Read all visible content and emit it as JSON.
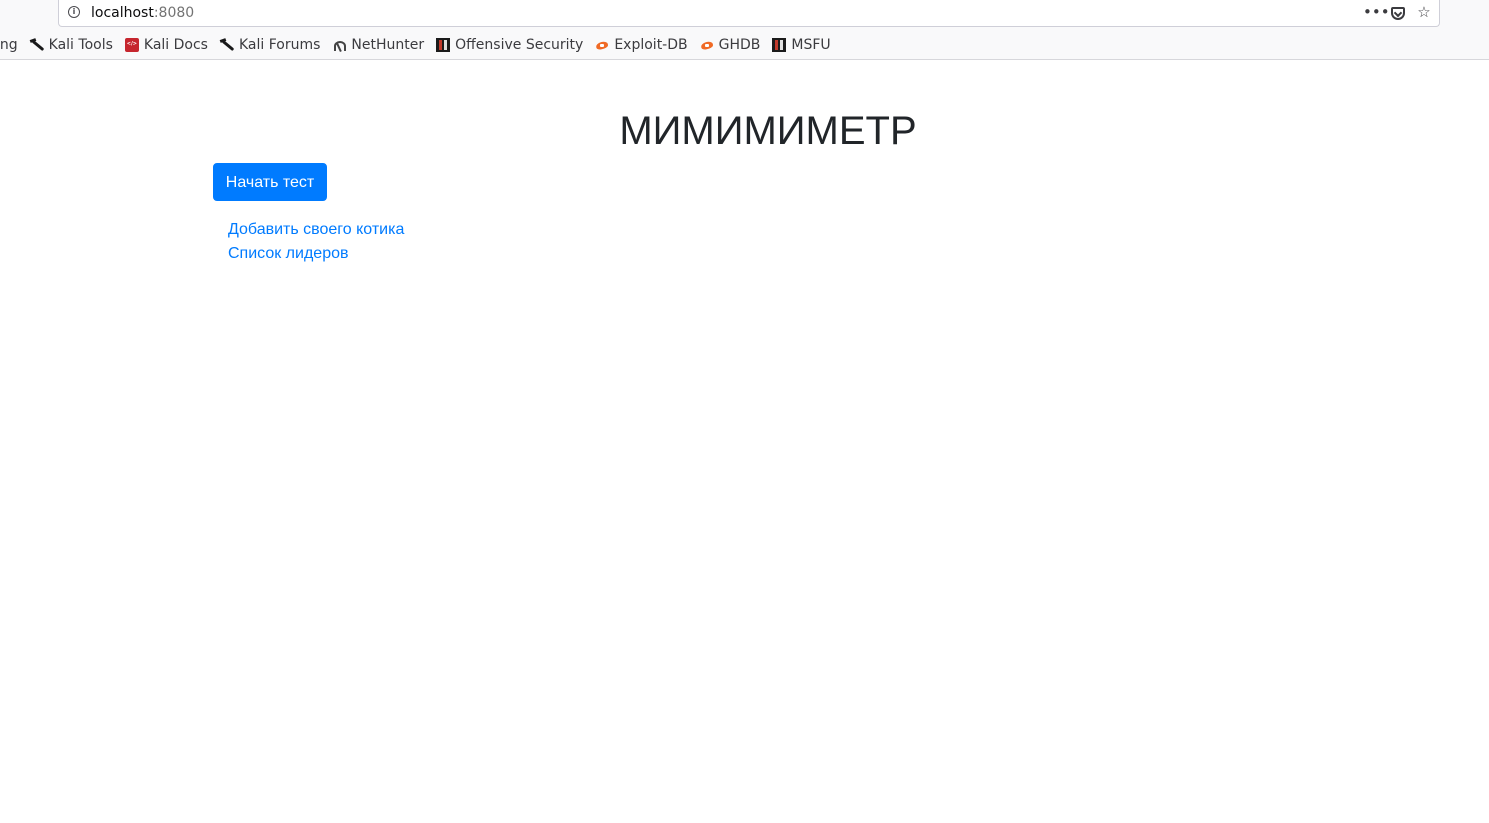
{
  "browser": {
    "url_host": "localhost",
    "url_port": ":8080",
    "bookmarks": [
      {
        "label": "ing",
        "icon": "partial-bookmark"
      },
      {
        "label": "Kali Tools",
        "icon": "kali-dragon-icon"
      },
      {
        "label": "Kali Docs",
        "icon": "kali-docs-icon"
      },
      {
        "label": "Kali Forums",
        "icon": "kali-dragon-icon"
      },
      {
        "label": "NetHunter",
        "icon": "nethunter-icon"
      },
      {
        "label": "Offensive Security",
        "icon": "offsec-icon"
      },
      {
        "label": "Exploit-DB",
        "icon": "exploit-db-icon"
      },
      {
        "label": "GHDB",
        "icon": "exploit-db-icon"
      },
      {
        "label": "MSFU",
        "icon": "offsec-icon"
      }
    ],
    "actions": {
      "menu": "•••",
      "star": "☆"
    }
  },
  "page": {
    "title": "МИМИМИМЕТР",
    "start_button": "Начать тест",
    "links": {
      "add_cat": "Добавить своего котика",
      "leaders": "Список лидеров"
    }
  },
  "colors": {
    "primary": "#007bff",
    "text": "#212529"
  }
}
